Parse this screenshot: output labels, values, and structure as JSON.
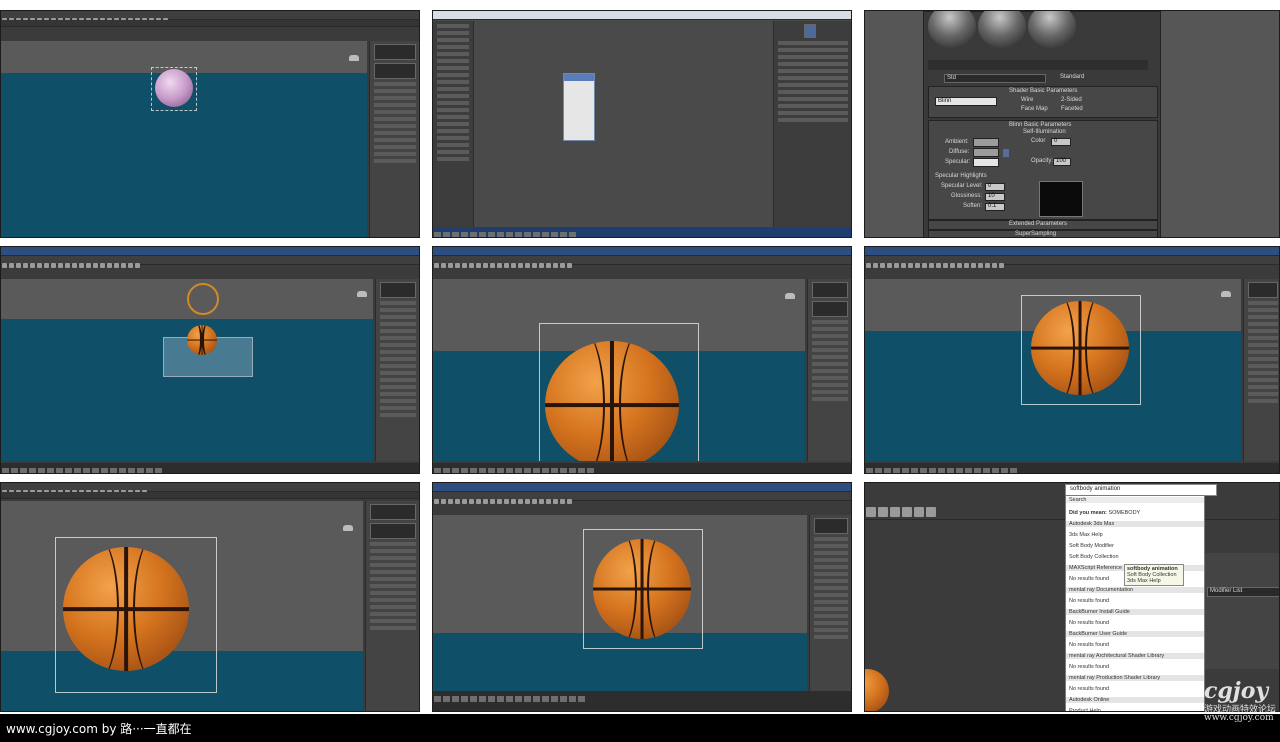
{
  "material_editor": {
    "shader_dropdown": "Std",
    "material_type": "Standard",
    "shader_basic_title": "Shader Basic Parameters",
    "shader_value": "Blinn",
    "wire": "Wire",
    "two_sided": "2-Sided",
    "face_map": "Face Map",
    "faceted": "Faceted",
    "blinn_title": "Blinn Basic Parameters",
    "self_illum": "Self-Illumination",
    "color": "Color",
    "color_value": "0",
    "ambient": "Ambient:",
    "diffuse": "Diffuse:",
    "specular": "Specular:",
    "opacity": "Opacity:",
    "opacity_value": "100",
    "specular_highlights": "Specular Highlights",
    "specular_level": "Specular Level:",
    "specular_level_value": "0",
    "glossiness": "Glossiness:",
    "glossiness_value": "10",
    "soften": "Soften:",
    "soften_value": "0.1",
    "extended": "Extended Parameters",
    "supersampling": "SuperSampling"
  },
  "search": {
    "query": "softbody animation",
    "search_label": "Search",
    "did_you_mean_prefix": "Did you mean:",
    "did_you_mean_term": "SOMEBODY",
    "sections": [
      {
        "title": "Autodesk 3ds Max",
        "items": [
          "3ds Max Help",
          "Soft Body Modifier",
          "Soft Body Collection"
        ]
      },
      {
        "title": "MAXScript Reference",
        "items": [
          "No results found"
        ]
      },
      {
        "title": "mental ray Documentation",
        "items": [
          "No results found"
        ]
      },
      {
        "title": "BackBurner Install Guide",
        "items": [
          "No results found"
        ]
      },
      {
        "title": "BackBurner User Guide",
        "items": [
          "No results found"
        ]
      },
      {
        "title": "mental ray Architectural Shader Library",
        "items": [
          "No results found"
        ]
      },
      {
        "title": "mental ray Production Shader Library",
        "items": [
          "No results found"
        ]
      },
      {
        "title": "Autodesk Online",
        "items": [
          "Product Help"
        ]
      }
    ],
    "tooltip": {
      "title": "softbody animation",
      "lines": [
        "Soft Body Collection",
        "3ds Max Help"
      ]
    },
    "modifier_list": "Modifier List"
  },
  "footer": {
    "credit": "www.cgjoy.com by 路···一直都在"
  },
  "watermark": {
    "logo": "cgjoy",
    "tagline": "游戏动画特效论坛",
    "url": "www.cgjoy.com"
  },
  "colors": {
    "floor": "#0f4f67",
    "ball": "#d5741f",
    "viewport": "#5a5a5a"
  }
}
